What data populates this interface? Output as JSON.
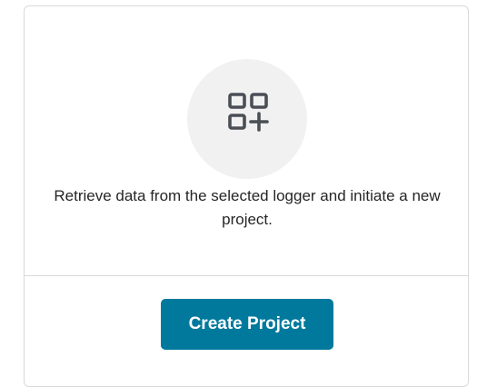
{
  "card": {
    "icon": "apps-add-icon",
    "description": "Retrieve data from the selected logger and initiate a new project.",
    "create_button_label": "Create Project"
  },
  "colors": {
    "button_bg": "#00799d",
    "button_text": "#ffffff",
    "icon_color": "#4a4f55",
    "icon_circle_bg": "#f1f1f2",
    "border": "#d9d9d9"
  }
}
